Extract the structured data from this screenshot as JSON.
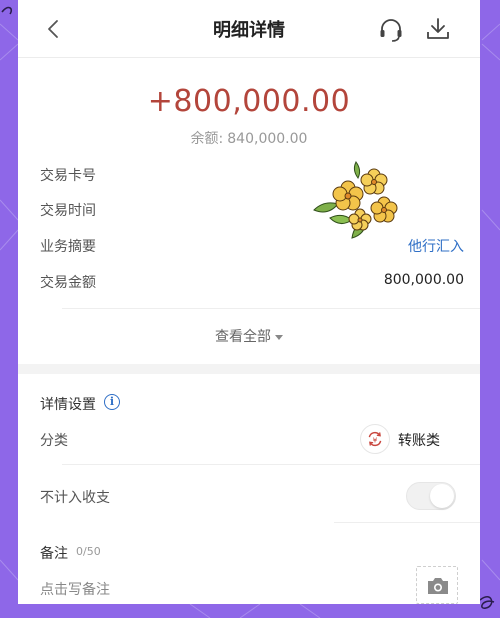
{
  "header": {
    "title": "明细详情",
    "back_icon": "chevron-left-icon",
    "support_icon": "headset-icon",
    "download_icon": "download-icon"
  },
  "summary": {
    "amount": "+800,000.00",
    "balance_label": "余额:",
    "balance_value": "840,000.00",
    "amount_color": "#b3453b"
  },
  "details": {
    "rows": [
      {
        "label": "交易卡号",
        "value": ""
      },
      {
        "label": "交易时间",
        "value": ""
      },
      {
        "label": "业务摘要",
        "value": "他行汇入"
      },
      {
        "label": "交易金额",
        "value": "800,000.00"
      }
    ],
    "view_all": "查看全部"
  },
  "settings": {
    "title": "详情设置",
    "info_icon": "info-icon",
    "category_label": "分类",
    "category_value": "转账类",
    "category_icon": "transfer-icon",
    "exclude_label": "不计入收支",
    "exclude_enabled": false,
    "note_label": "备注",
    "note_count": "0/50",
    "note_placeholder": "点击写备注",
    "note_value": "",
    "photo_icon": "camera-icon"
  },
  "colors": {
    "accent_link": "#2f6fc6",
    "frame_background": "#8e67e8"
  }
}
